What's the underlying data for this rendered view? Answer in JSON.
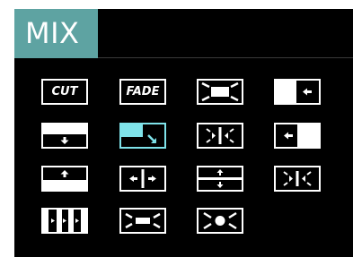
{
  "header": {
    "title": "MIX"
  },
  "accent_color": "#5ea3a2",
  "active_color": "#7fe3ea",
  "transitions": [
    {
      "id": "cut",
      "label": "CUT",
      "icon": "cut-text"
    },
    {
      "id": "fade",
      "label": "FADE",
      "icon": "fade-text"
    },
    {
      "id": "iris-out-corners",
      "label": "",
      "icon": "corner-arrows-out-icon"
    },
    {
      "id": "wipe-right",
      "label": "",
      "icon": "wipe-right-icon"
    },
    {
      "id": "wipe-down",
      "label": "",
      "icon": "wipe-down-icon"
    },
    {
      "id": "corner-wipe-down-right",
      "label": "",
      "icon": "corner-wipe-icon",
      "selected": true
    },
    {
      "id": "split-in-horizontal",
      "label": "",
      "icon": "split-in-icon"
    },
    {
      "id": "wipe-left",
      "label": "",
      "icon": "wipe-left-icon"
    },
    {
      "id": "wipe-up",
      "label": "",
      "icon": "wipe-up-icon"
    },
    {
      "id": "barn-door-horizontal",
      "label": "",
      "icon": "barn-door-horizontal-icon"
    },
    {
      "id": "barn-door-vertical",
      "label": "",
      "icon": "barn-door-vertical-icon"
    },
    {
      "id": "split-in-diagonal",
      "label": "",
      "icon": "split-diagonal-icon"
    },
    {
      "id": "bars-right",
      "label": "",
      "icon": "bars-right-icon"
    },
    {
      "id": "box-out",
      "label": "",
      "icon": "box-out-icon"
    },
    {
      "id": "circle-out",
      "label": "",
      "icon": "circle-out-icon"
    }
  ]
}
